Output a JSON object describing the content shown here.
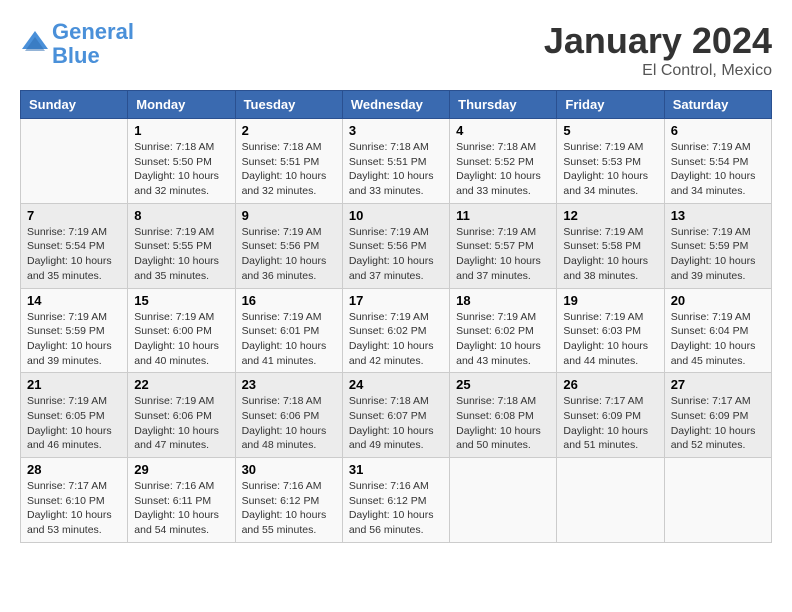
{
  "header": {
    "logo_line1": "General",
    "logo_line2": "Blue",
    "month_title": "January 2024",
    "location": "El Control, Mexico"
  },
  "days_of_week": [
    "Sunday",
    "Monday",
    "Tuesday",
    "Wednesday",
    "Thursday",
    "Friday",
    "Saturday"
  ],
  "weeks": [
    [
      {
        "day": "",
        "info": ""
      },
      {
        "day": "1",
        "info": "Sunrise: 7:18 AM\nSunset: 5:50 PM\nDaylight: 10 hours\nand 32 minutes."
      },
      {
        "day": "2",
        "info": "Sunrise: 7:18 AM\nSunset: 5:51 PM\nDaylight: 10 hours\nand 32 minutes."
      },
      {
        "day": "3",
        "info": "Sunrise: 7:18 AM\nSunset: 5:51 PM\nDaylight: 10 hours\nand 33 minutes."
      },
      {
        "day": "4",
        "info": "Sunrise: 7:18 AM\nSunset: 5:52 PM\nDaylight: 10 hours\nand 33 minutes."
      },
      {
        "day": "5",
        "info": "Sunrise: 7:19 AM\nSunset: 5:53 PM\nDaylight: 10 hours\nand 34 minutes."
      },
      {
        "day": "6",
        "info": "Sunrise: 7:19 AM\nSunset: 5:54 PM\nDaylight: 10 hours\nand 34 minutes."
      }
    ],
    [
      {
        "day": "7",
        "info": "Sunrise: 7:19 AM\nSunset: 5:54 PM\nDaylight: 10 hours\nand 35 minutes."
      },
      {
        "day": "8",
        "info": "Sunrise: 7:19 AM\nSunset: 5:55 PM\nDaylight: 10 hours\nand 35 minutes."
      },
      {
        "day": "9",
        "info": "Sunrise: 7:19 AM\nSunset: 5:56 PM\nDaylight: 10 hours\nand 36 minutes."
      },
      {
        "day": "10",
        "info": "Sunrise: 7:19 AM\nSunset: 5:56 PM\nDaylight: 10 hours\nand 37 minutes."
      },
      {
        "day": "11",
        "info": "Sunrise: 7:19 AM\nSunset: 5:57 PM\nDaylight: 10 hours\nand 37 minutes."
      },
      {
        "day": "12",
        "info": "Sunrise: 7:19 AM\nSunset: 5:58 PM\nDaylight: 10 hours\nand 38 minutes."
      },
      {
        "day": "13",
        "info": "Sunrise: 7:19 AM\nSunset: 5:59 PM\nDaylight: 10 hours\nand 39 minutes."
      }
    ],
    [
      {
        "day": "14",
        "info": "Sunrise: 7:19 AM\nSunset: 5:59 PM\nDaylight: 10 hours\nand 39 minutes."
      },
      {
        "day": "15",
        "info": "Sunrise: 7:19 AM\nSunset: 6:00 PM\nDaylight: 10 hours\nand 40 minutes."
      },
      {
        "day": "16",
        "info": "Sunrise: 7:19 AM\nSunset: 6:01 PM\nDaylight: 10 hours\nand 41 minutes."
      },
      {
        "day": "17",
        "info": "Sunrise: 7:19 AM\nSunset: 6:02 PM\nDaylight: 10 hours\nand 42 minutes."
      },
      {
        "day": "18",
        "info": "Sunrise: 7:19 AM\nSunset: 6:02 PM\nDaylight: 10 hours\nand 43 minutes."
      },
      {
        "day": "19",
        "info": "Sunrise: 7:19 AM\nSunset: 6:03 PM\nDaylight: 10 hours\nand 44 minutes."
      },
      {
        "day": "20",
        "info": "Sunrise: 7:19 AM\nSunset: 6:04 PM\nDaylight: 10 hours\nand 45 minutes."
      }
    ],
    [
      {
        "day": "21",
        "info": "Sunrise: 7:19 AM\nSunset: 6:05 PM\nDaylight: 10 hours\nand 46 minutes."
      },
      {
        "day": "22",
        "info": "Sunrise: 7:19 AM\nSunset: 6:06 PM\nDaylight: 10 hours\nand 47 minutes."
      },
      {
        "day": "23",
        "info": "Sunrise: 7:18 AM\nSunset: 6:06 PM\nDaylight: 10 hours\nand 48 minutes."
      },
      {
        "day": "24",
        "info": "Sunrise: 7:18 AM\nSunset: 6:07 PM\nDaylight: 10 hours\nand 49 minutes."
      },
      {
        "day": "25",
        "info": "Sunrise: 7:18 AM\nSunset: 6:08 PM\nDaylight: 10 hours\nand 50 minutes."
      },
      {
        "day": "26",
        "info": "Sunrise: 7:17 AM\nSunset: 6:09 PM\nDaylight: 10 hours\nand 51 minutes."
      },
      {
        "day": "27",
        "info": "Sunrise: 7:17 AM\nSunset: 6:09 PM\nDaylight: 10 hours\nand 52 minutes."
      }
    ],
    [
      {
        "day": "28",
        "info": "Sunrise: 7:17 AM\nSunset: 6:10 PM\nDaylight: 10 hours\nand 53 minutes."
      },
      {
        "day": "29",
        "info": "Sunrise: 7:16 AM\nSunset: 6:11 PM\nDaylight: 10 hours\nand 54 minutes."
      },
      {
        "day": "30",
        "info": "Sunrise: 7:16 AM\nSunset: 6:12 PM\nDaylight: 10 hours\nand 55 minutes."
      },
      {
        "day": "31",
        "info": "Sunrise: 7:16 AM\nSunset: 6:12 PM\nDaylight: 10 hours\nand 56 minutes."
      },
      {
        "day": "",
        "info": ""
      },
      {
        "day": "",
        "info": ""
      },
      {
        "day": "",
        "info": ""
      }
    ]
  ]
}
